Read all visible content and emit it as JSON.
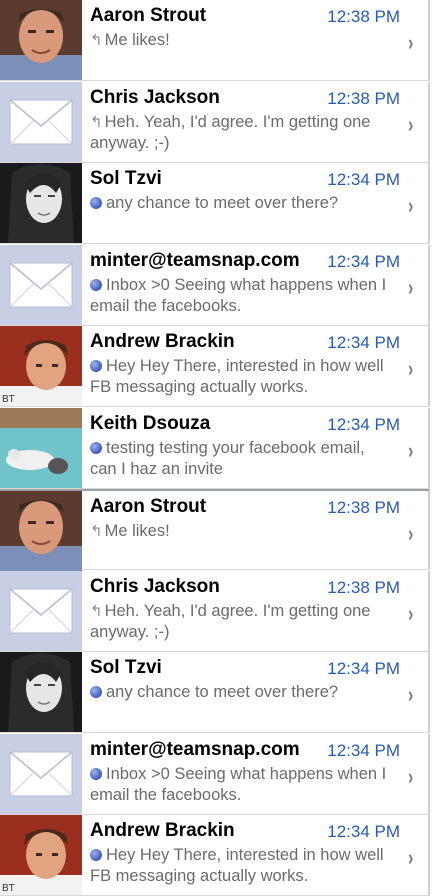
{
  "messages": [
    {
      "sender": "Aaron Strout",
      "time": "12:38 PM",
      "status": "replied",
      "status_icon": "reply-icon",
      "preview": "Me likes!",
      "avatar": "photo-aaron"
    },
    {
      "sender": "Chris Jackson",
      "time": "12:38 PM",
      "status": "replied",
      "status_icon": "reply-icon",
      "preview": "Heh. Yeah, I'd agree. I'm getting one anyway. ;-)",
      "avatar": "envelope"
    },
    {
      "sender": "Sol Tzvi",
      "time": "12:34 PM",
      "status": "unread",
      "status_icon": "unread-dot-icon",
      "preview": "any chance to meet over there?",
      "avatar": "photo-sol"
    },
    {
      "sender": "minter@teamsnap.com",
      "time": "12:34 PM",
      "status": "unread",
      "status_icon": "unread-dot-icon",
      "preview": "Inbox >0 Seeing what happens when I email the facebooks.",
      "avatar": "envelope"
    },
    {
      "sender": "Andrew Brackin",
      "time": "12:34 PM",
      "status": "unread",
      "status_icon": "unread-dot-icon",
      "preview": "Hey Hey There, interested in how well FB messaging actually works.",
      "avatar": "photo-andrew"
    },
    {
      "sender": "Keith Dsouza",
      "time": "12:34 PM",
      "status": "unread",
      "status_icon": "unread-dot-icon",
      "preview": "testing testing your facebook email, can I haz an invite",
      "avatar": "photo-keith"
    },
    {
      "sender": "Aaron Strout",
      "time": "12:38 PM",
      "status": "replied",
      "status_icon": "reply-icon",
      "preview": "Me likes!",
      "avatar": "photo-aaron"
    },
    {
      "sender": "Chris Jackson",
      "time": "12:38 PM",
      "status": "replied",
      "status_icon": "reply-icon",
      "preview": "Heh. Yeah, I'd agree. I'm getting one anyway. ;-)",
      "avatar": "envelope"
    },
    {
      "sender": "Sol Tzvi",
      "time": "12:34 PM",
      "status": "unread",
      "status_icon": "unread-dot-icon",
      "preview": "any chance to meet over there?",
      "avatar": "photo-sol"
    },
    {
      "sender": "minter@teamsnap.com",
      "time": "12:34 PM",
      "status": "unread",
      "status_icon": "unread-dot-icon",
      "preview": "Inbox >0 Seeing what happens when I email the facebooks.",
      "avatar": "envelope"
    },
    {
      "sender": "Andrew Brackin",
      "time": "12:34 PM",
      "status": "unread",
      "status_icon": "unread-dot-icon",
      "preview": "Hey Hey There, interested in how well FB messaging actually works.",
      "avatar": "photo-andrew"
    }
  ],
  "colors": {
    "time": "#2a5bb0",
    "unread_dot": "#4a66c4",
    "envelope_bg": "#c8cee3"
  }
}
